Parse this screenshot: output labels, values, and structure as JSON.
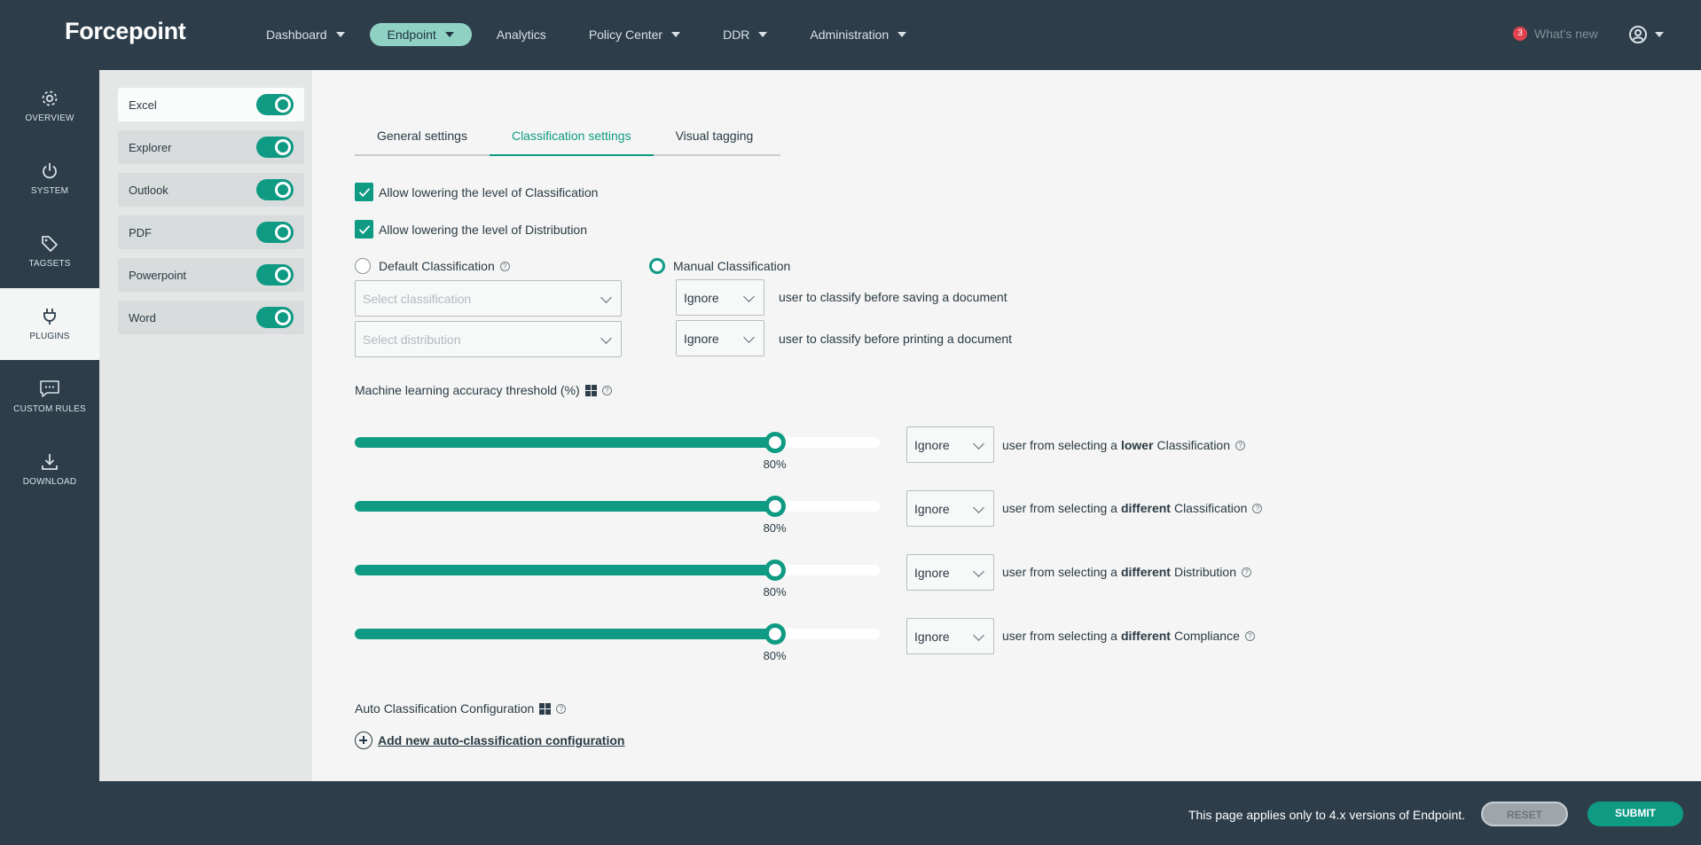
{
  "header": {
    "logo": "Forcepoint",
    "nav": [
      {
        "label": "Dashboard",
        "has_menu": true,
        "active": false
      },
      {
        "label": "Endpoint",
        "has_menu": true,
        "active": true
      },
      {
        "label": "Analytics",
        "has_menu": false,
        "active": false
      },
      {
        "label": "Policy Center",
        "has_menu": true,
        "active": false
      },
      {
        "label": "DDR",
        "has_menu": true,
        "active": false
      },
      {
        "label": "Administration",
        "has_menu": true,
        "active": false
      }
    ],
    "whats_new_count": "3",
    "whats_new_label": "What's new",
    "user_icon": "user-circle-icon"
  },
  "rail": {
    "items": [
      {
        "label": "OVERVIEW",
        "icon": "gear-icon",
        "active": false
      },
      {
        "label": "SYSTEM",
        "icon": "power-icon",
        "active": false
      },
      {
        "label": "TAGSETS",
        "icon": "tag-icon",
        "active": false
      },
      {
        "label": "PLUGINS",
        "icon": "plug-icon",
        "active": true
      },
      {
        "label": "CUSTOM RULES",
        "icon": "chat-icon",
        "active": false
      },
      {
        "label": "DOWNLOAD",
        "icon": "download-icon",
        "active": false
      }
    ]
  },
  "plugins": [
    {
      "name": "Excel",
      "enabled": true,
      "selected": true
    },
    {
      "name": "Explorer",
      "enabled": true,
      "selected": false
    },
    {
      "name": "Outlook",
      "enabled": true,
      "selected": false
    },
    {
      "name": "PDF",
      "enabled": true,
      "selected": false
    },
    {
      "name": "Powerpoint",
      "enabled": true,
      "selected": false
    },
    {
      "name": "Word",
      "enabled": true,
      "selected": false
    }
  ],
  "tabs": [
    "General settings",
    "Classification settings",
    "Visual tagging"
  ],
  "active_tab": "Classification settings",
  "checks": {
    "lower_classification": "Allow lowering the level of Classification",
    "lower_distribution": "Allow lowering the level of Distribution"
  },
  "default_classification": {
    "label": "Default Classification",
    "classification_placeholder": "Select classification",
    "distribution_placeholder": "Select distribution"
  },
  "manual_classification": {
    "label": "Manual Classification",
    "save_action": "Ignore",
    "save_text": "user to classify before saving a document",
    "print_action": "Ignore",
    "print_text": "user to classify before printing a document"
  },
  "ml": {
    "label": "Machine learning accuracy threshold (%)",
    "rows": [
      {
        "percent": 80,
        "value_label": "80%",
        "action": "Ignore",
        "prefix": "user from selecting a",
        "bold": "lower",
        "suffix": "Classification"
      },
      {
        "percent": 80,
        "value_label": "80%",
        "action": "Ignore",
        "prefix": "user from selecting a",
        "bold": "different",
        "suffix": "Classification"
      },
      {
        "percent": 80,
        "value_label": "80%",
        "action": "Ignore",
        "prefix": "user from selecting a",
        "bold": "different",
        "suffix": "Distribution"
      },
      {
        "percent": 80,
        "value_label": "80%",
        "action": "Ignore",
        "prefix": "user from selecting a",
        "bold": "different",
        "suffix": "Compliance"
      }
    ]
  },
  "auto": {
    "label": "Auto Classification Configuration",
    "add_link": "Add new auto-classification configuration"
  },
  "footer": {
    "note": "This page applies only to 4.x versions of Endpoint.",
    "reset": "RESET",
    "submit": "SUBMIT"
  },
  "colors": {
    "accent": "#0f9a84",
    "nav_bg": "#2d3e4a",
    "badge": "#e0434f"
  }
}
